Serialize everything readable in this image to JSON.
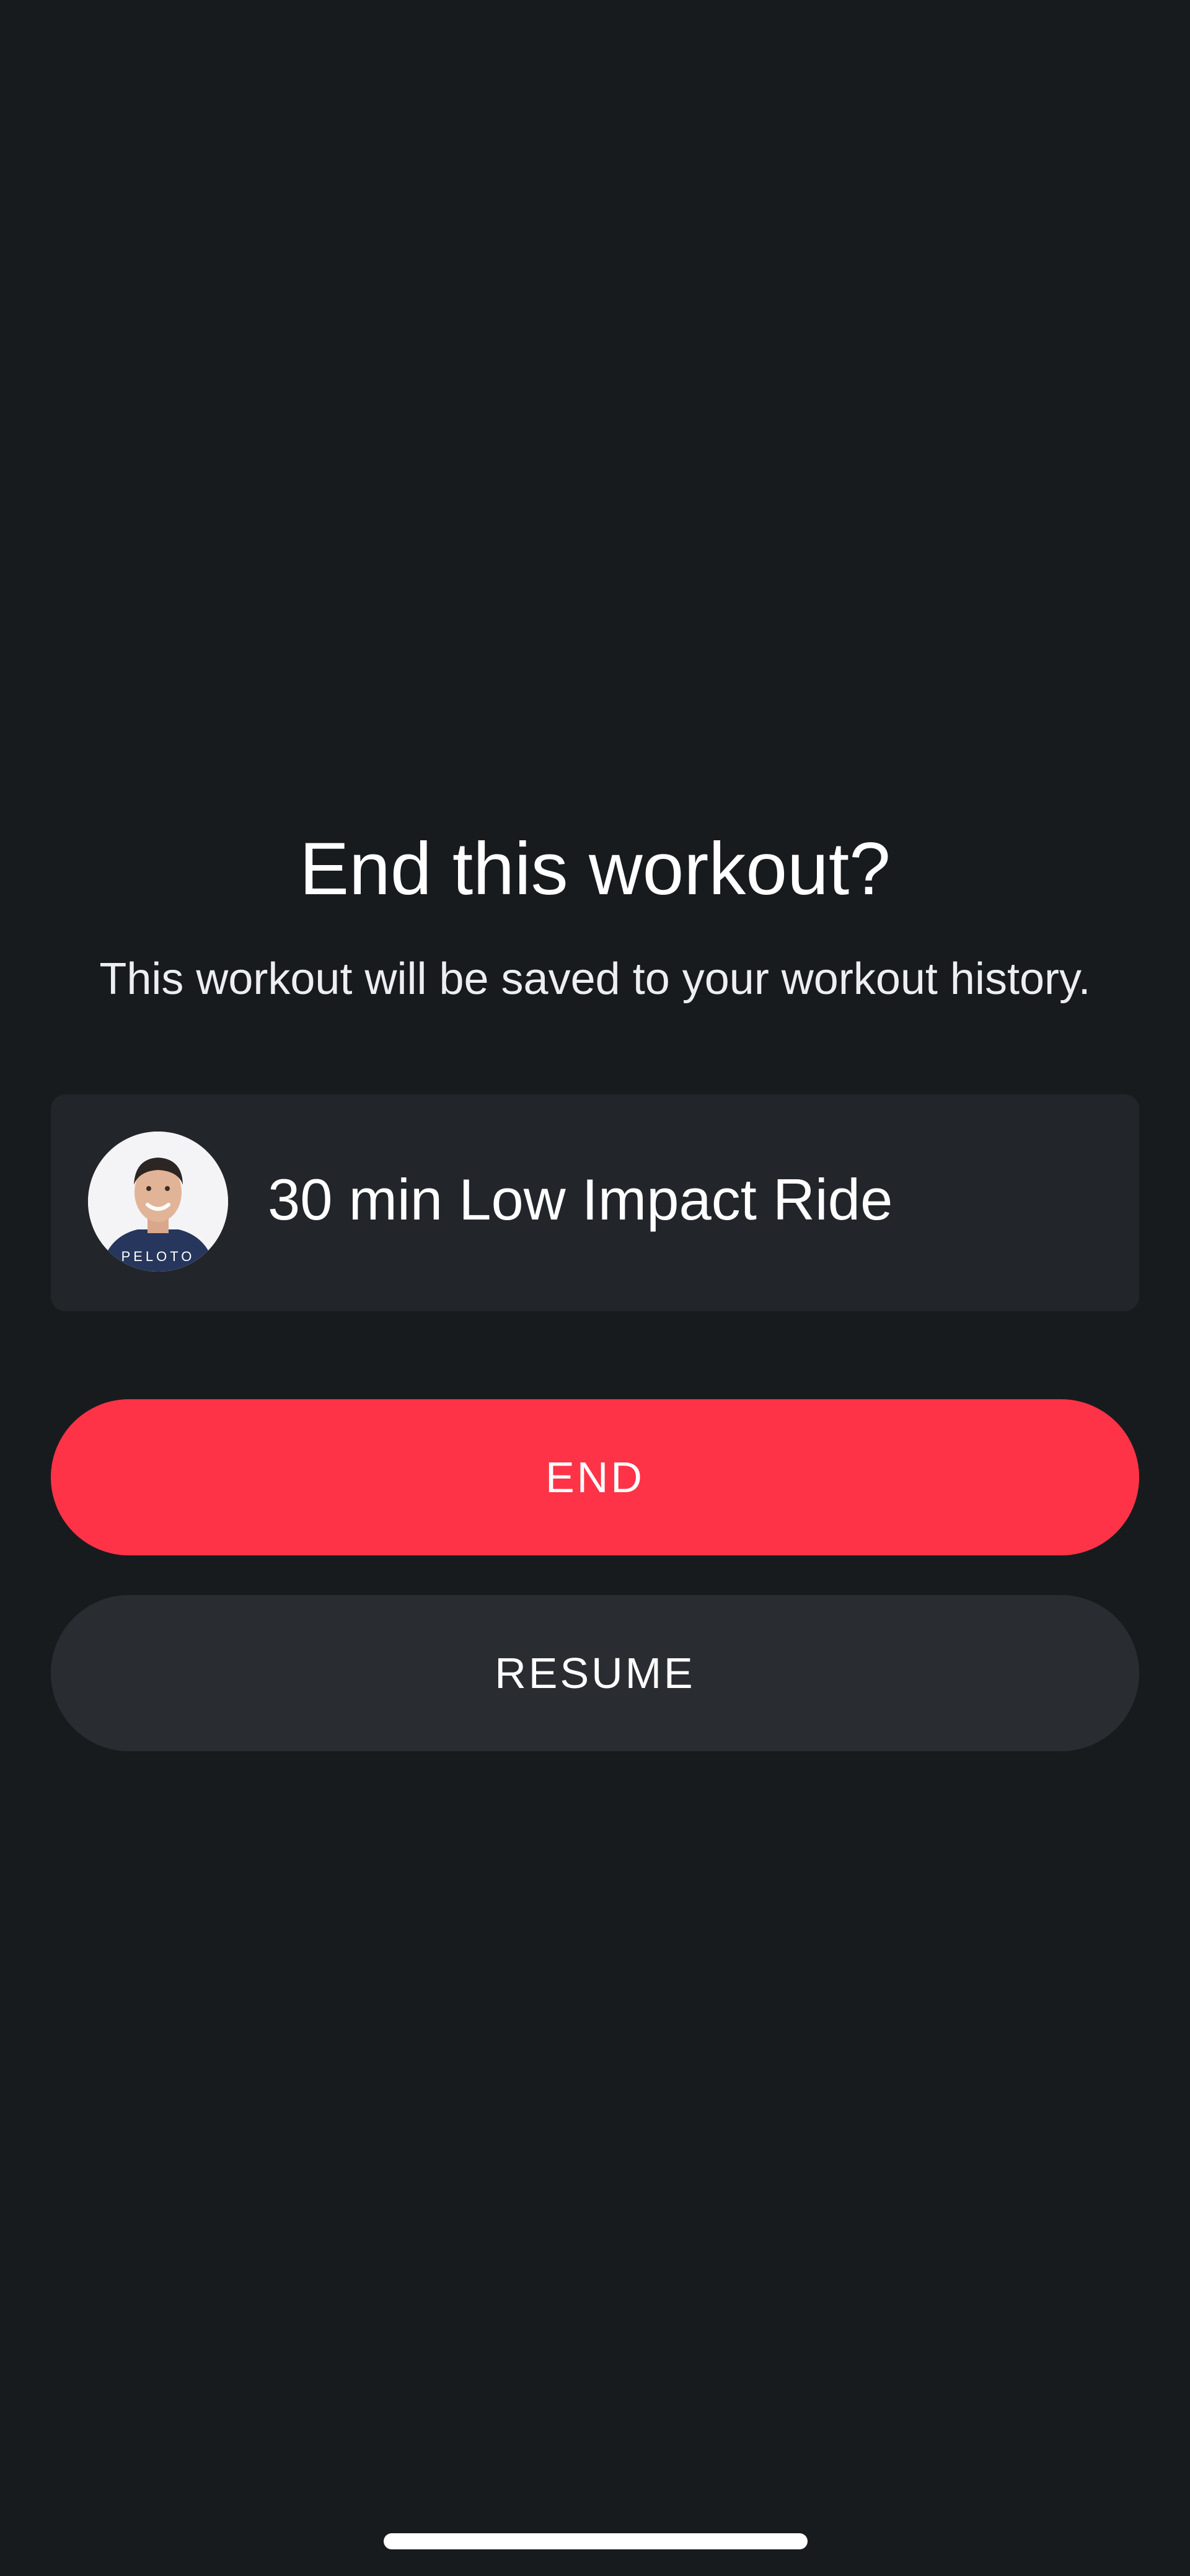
{
  "dialog": {
    "title": "End this workout?",
    "subtitle": "This workout will be saved to your workout history."
  },
  "class_card": {
    "title": "30 min Low Impact Ride",
    "instructor_avatar_shirt_text": "PELOTO"
  },
  "actions": {
    "end_label": "END",
    "resume_label": "RESUME"
  },
  "colors": {
    "background": "#181b1e",
    "card": "#22252a",
    "end_button": "#ff3347",
    "resume_button": "#292d31",
    "text": "#ffffff"
  }
}
